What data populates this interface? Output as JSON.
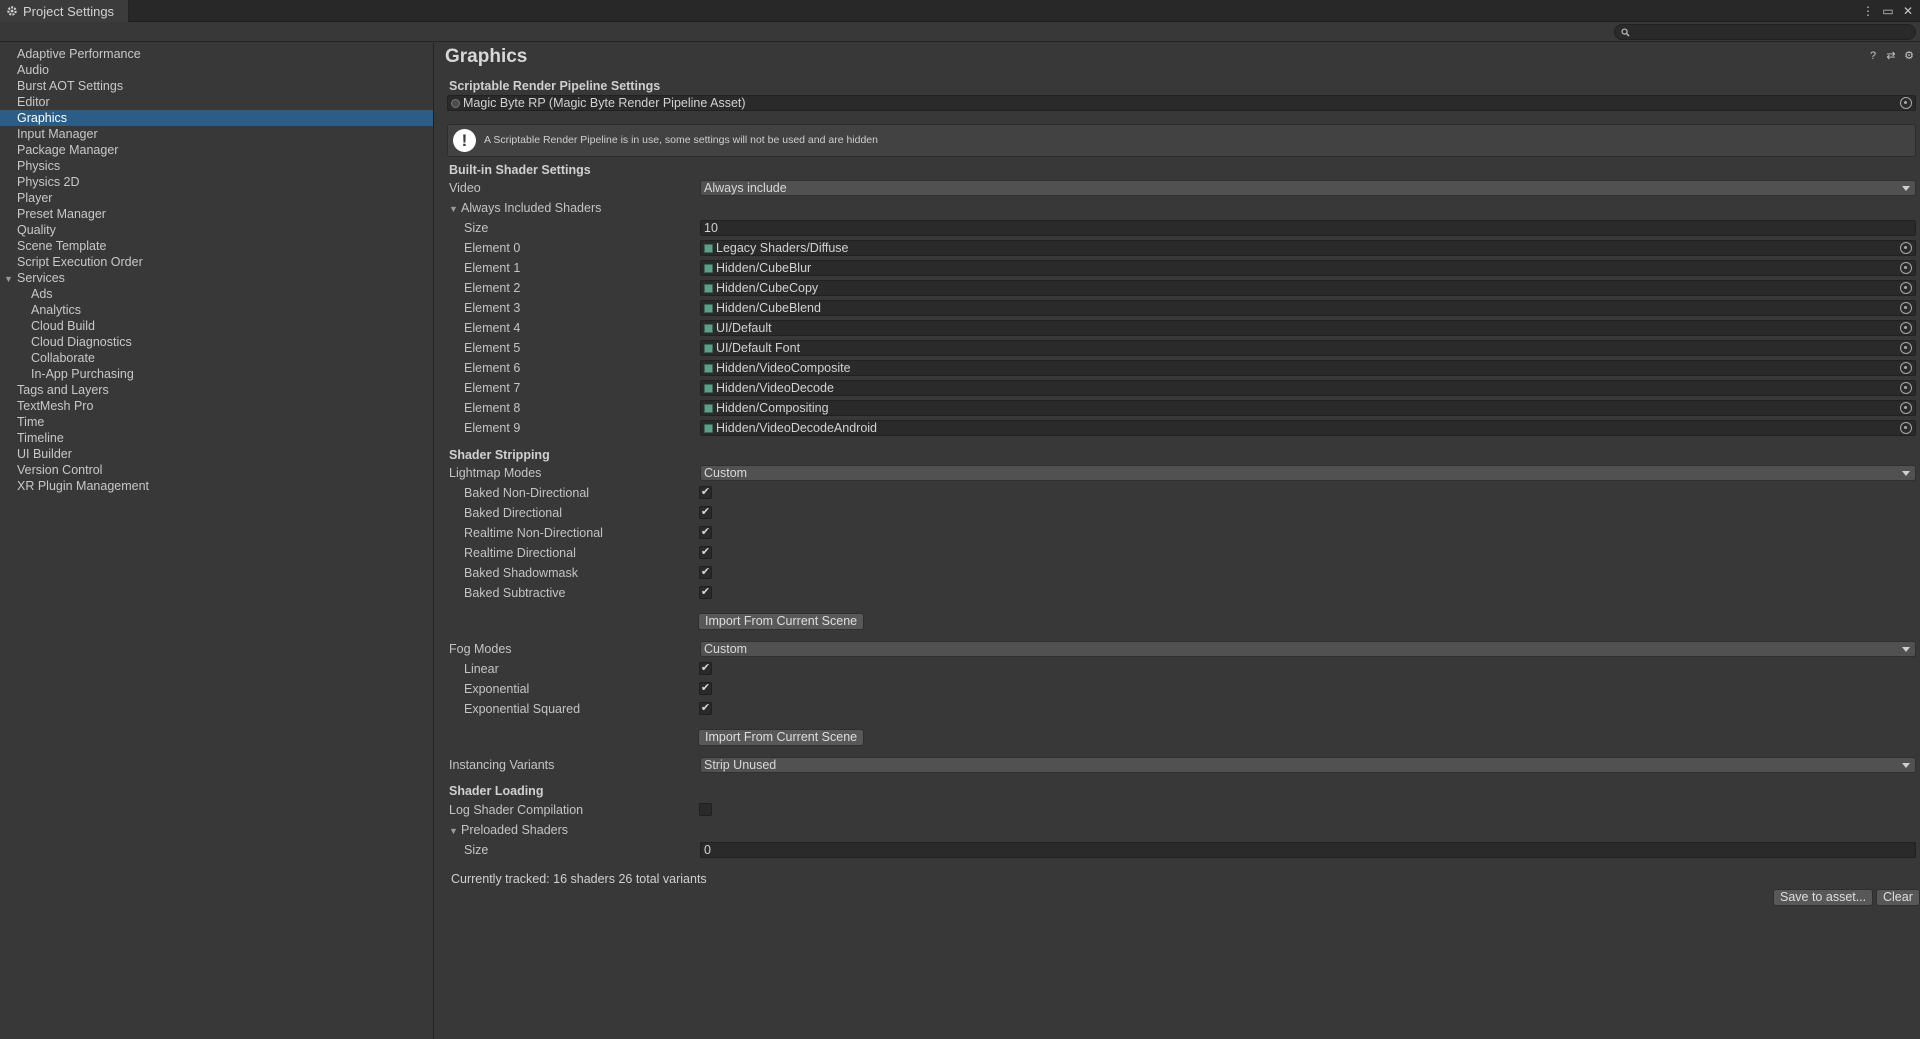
{
  "window": {
    "tab_title": "Project Settings",
    "controls": [
      "more-icon",
      "maximize-icon",
      "close-icon"
    ]
  },
  "search": {
    "placeholder": ""
  },
  "sidebar": {
    "items": [
      {
        "label": "Adaptive Performance",
        "level": 0
      },
      {
        "label": "Audio",
        "level": 0
      },
      {
        "label": "Burst AOT Settings",
        "level": 0
      },
      {
        "label": "Editor",
        "level": 0
      },
      {
        "label": "Graphics",
        "level": 0,
        "selected": true
      },
      {
        "label": "Input Manager",
        "level": 0
      },
      {
        "label": "Package Manager",
        "level": 0
      },
      {
        "label": "Physics",
        "level": 0
      },
      {
        "label": "Physics 2D",
        "level": 0
      },
      {
        "label": "Player",
        "level": 0
      },
      {
        "label": "Preset Manager",
        "level": 0
      },
      {
        "label": "Quality",
        "level": 0
      },
      {
        "label": "Scene Template",
        "level": 0
      },
      {
        "label": "Script Execution Order",
        "level": 0
      },
      {
        "label": "Services",
        "level": 0,
        "expanded": true
      },
      {
        "label": "Ads",
        "level": 1
      },
      {
        "label": "Analytics",
        "level": 1
      },
      {
        "label": "Cloud Build",
        "level": 1
      },
      {
        "label": "Cloud Diagnostics",
        "level": 1
      },
      {
        "label": "Collaborate",
        "level": 1
      },
      {
        "label": "In-App Purchasing",
        "level": 1
      },
      {
        "label": "Tags and Layers",
        "level": 0
      },
      {
        "label": "TextMesh Pro",
        "level": 0
      },
      {
        "label": "Time",
        "level": 0
      },
      {
        "label": "Timeline",
        "level": 0
      },
      {
        "label": "UI Builder",
        "level": 0
      },
      {
        "label": "Version Control",
        "level": 0
      },
      {
        "label": "XR Plugin Management",
        "level": 0
      }
    ]
  },
  "main": {
    "title": "Graphics",
    "srp": {
      "section": "Scriptable Render Pipeline Settings",
      "asset": "Magic Byte RP (Magic Byte Render Pipeline Asset)",
      "help": "A Scriptable Render Pipeline is in use, some settings will not be used and are hidden"
    },
    "builtin": {
      "section": "Built-in Shader Settings",
      "video_label": "Video",
      "video_value": "Always include",
      "always_included_label": "Always Included Shaders",
      "size_label": "Size",
      "size_value": "10",
      "elements": [
        {
          "label": "Element 0",
          "value": "Legacy Shaders/Diffuse"
        },
        {
          "label": "Element 1",
          "value": "Hidden/CubeBlur"
        },
        {
          "label": "Element 2",
          "value": "Hidden/CubeCopy"
        },
        {
          "label": "Element 3",
          "value": "Hidden/CubeBlend"
        },
        {
          "label": "Element 4",
          "value": "UI/Default"
        },
        {
          "label": "Element 5",
          "value": "UI/Default Font"
        },
        {
          "label": "Element 6",
          "value": "Hidden/VideoComposite"
        },
        {
          "label": "Element 7",
          "value": "Hidden/VideoDecode"
        },
        {
          "label": "Element 8",
          "value": "Hidden/Compositing"
        },
        {
          "label": "Element 9",
          "value": "Hidden/VideoDecodeAndroid"
        }
      ]
    },
    "stripping": {
      "section": "Shader Stripping",
      "lightmap_label": "Lightmap Modes",
      "lightmap_value": "Custom",
      "lightmap_options": [
        {
          "label": "Baked Non-Directional",
          "checked": true
        },
        {
          "label": "Baked Directional",
          "checked": true
        },
        {
          "label": "Realtime Non-Directional",
          "checked": true
        },
        {
          "label": "Realtime Directional",
          "checked": true
        },
        {
          "label": "Baked Shadowmask",
          "checked": true
        },
        {
          "label": "Baked Subtractive",
          "checked": true
        }
      ],
      "import_button": "Import From Current Scene",
      "fog_label": "Fog Modes",
      "fog_value": "Custom",
      "fog_options": [
        {
          "label": "Linear",
          "checked": true
        },
        {
          "label": "Exponential",
          "checked": true
        },
        {
          "label": "Exponential Squared",
          "checked": true
        }
      ],
      "import_button_2": "Import From Current Scene",
      "instancing_label": "Instancing Variants",
      "instancing_value": "Strip Unused"
    },
    "loading": {
      "section": "Shader Loading",
      "log_label": "Log Shader Compilation",
      "log_checked": false,
      "preloaded_label": "Preloaded Shaders",
      "size_label": "Size",
      "size_value": "0",
      "tracked": "Currently tracked: 16 shaders 26 total variants",
      "save_button": "Save to asset...",
      "clear_button": "Clear"
    }
  }
}
